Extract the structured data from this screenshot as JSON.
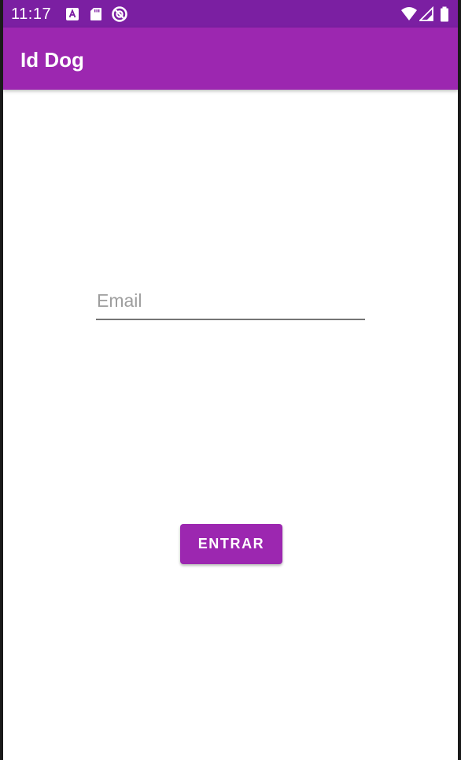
{
  "status_bar": {
    "time": "11:17",
    "left_icons": [
      "font-a-icon",
      "sd-card-icon",
      "no-entry-circle-icon"
    ],
    "right_icons": [
      "wifi-icon",
      "cellular-signal-icon",
      "battery-icon"
    ],
    "background": "#7b1fa2"
  },
  "app_bar": {
    "title": "Id Dog",
    "background": "#9c27b0"
  },
  "login": {
    "email_placeholder": "Email",
    "email_value": "",
    "enter_label": "ENTRAR"
  },
  "colors": {
    "primary": "#9c27b0",
    "primary_dark": "#7b1fa2",
    "background": "#ffffff"
  }
}
